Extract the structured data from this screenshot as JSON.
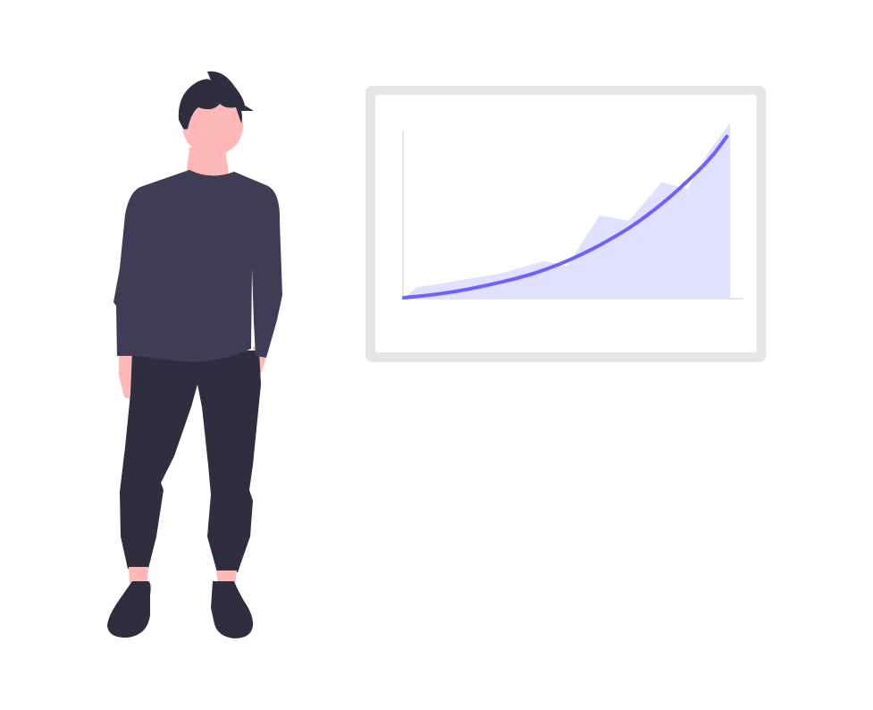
{
  "illustration": {
    "subject": "person-with-growth-chart",
    "colors": {
      "background": "#ffffff",
      "frame_border": "#e6e6e6",
      "frame_inner": "#ffffff",
      "axis": "#e6e6e6",
      "area_fill": "#e2e0ff",
      "trend_line": "#6c63ff",
      "skin": "#ffb8b8",
      "hair": "#2f2e41",
      "shirt": "#3f3d56",
      "pants": "#2f2e41",
      "shoes": "#2f2e41"
    }
  },
  "chart_data": {
    "type": "area",
    "title": "",
    "xlabel": "",
    "ylabel": "",
    "area_series": {
      "x": [
        0,
        0.04,
        0.11,
        0.3,
        0.43,
        0.5,
        0.6,
        0.69,
        0.79,
        0.87,
        0.93,
        1.0
      ],
      "values": [
        0,
        0.06,
        0.08,
        0.14,
        0.21,
        0.18,
        0.47,
        0.44,
        0.66,
        0.62,
        0.82,
        1.0
      ]
    },
    "trend_series": {
      "x": [
        0,
        0.1,
        0.2,
        0.3,
        0.4,
        0.5,
        0.6,
        0.7,
        0.8,
        0.9,
        0.95,
        0.99
      ],
      "values": [
        0,
        0.02,
        0.05,
        0.09,
        0.14,
        0.21,
        0.3,
        0.41,
        0.55,
        0.72,
        0.82,
        0.92
      ]
    },
    "xlim": [
      0,
      1
    ],
    "ylim": [
      0,
      1
    ],
    "grid": false,
    "legend": "none"
  }
}
